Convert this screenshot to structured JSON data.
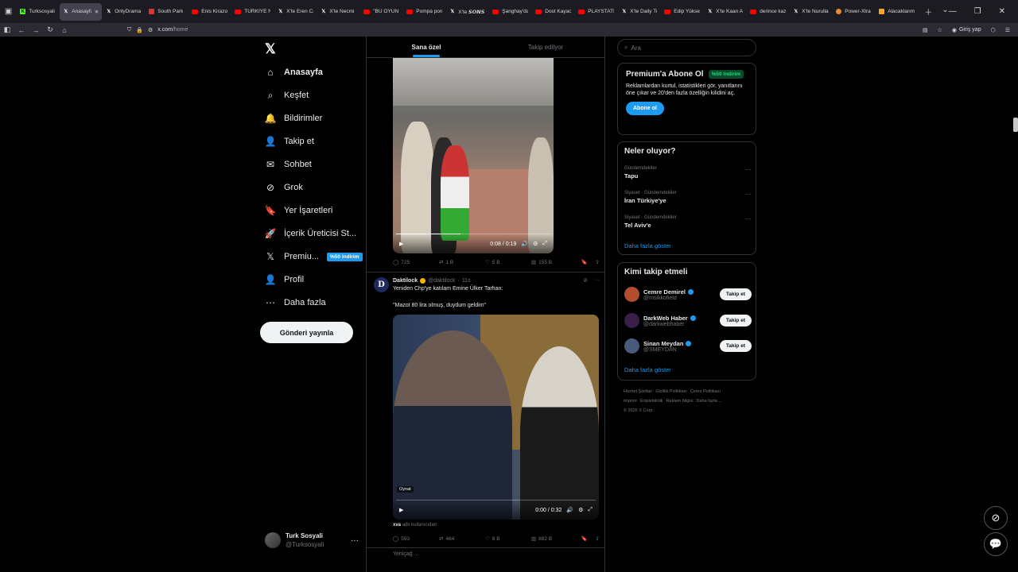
{
  "browser": {
    "tabs": [
      {
        "label": "Turksosyali",
        "fav": "k"
      },
      {
        "label": "Anasayfa",
        "fav": "x",
        "active": true
      },
      {
        "label": "OnlyDrama",
        "fav": "x"
      },
      {
        "label": "South Park",
        "fav": "red"
      },
      {
        "label": "Enis Kirazoğ",
        "fav": "yt"
      },
      {
        "label": "TÜRKİYE NA",
        "fav": "yt"
      },
      {
        "label": "X'te Eren Ca",
        "fav": "x"
      },
      {
        "label": "X'te Necmi",
        "fav": "x"
      },
      {
        "label": "\"BU OYUN",
        "fav": "yt"
      },
      {
        "label": "Pompa porn",
        "fav": "yt"
      },
      {
        "label": "X'te 𝙎𝙊𝙉𝙎",
        "fav": "x"
      },
      {
        "label": "Şanghay'da",
        "fav": "yt"
      },
      {
        "label": "Dost Kayaoğ",
        "fav": "yt"
      },
      {
        "label": "PLAYSTATIC",
        "fav": "yt"
      },
      {
        "label": "X'te Daily Tu",
        "fav": "x"
      },
      {
        "label": "Edip Yüksel",
        "fav": "yt"
      },
      {
        "label": "X'te Kaan Ak",
        "fav": "x"
      },
      {
        "label": "derince kazı",
        "fav": "yt"
      },
      {
        "label": "X'te Nurulla",
        "fav": "x"
      },
      {
        "label": "Power-Xtra",
        "fav": "orange"
      },
      {
        "label": "Alacaklarım",
        "fav": "amber"
      }
    ],
    "url_host": "x.com",
    "url_path": "/home",
    "signin_label": "Giriş yap"
  },
  "nav": {
    "items": [
      {
        "label": "Anasayfa",
        "icon": "home-icon",
        "glyph": "⌂",
        "bold": true
      },
      {
        "label": "Keşfet",
        "icon": "search-icon",
        "glyph": "⌕"
      },
      {
        "label": "Bildirimler",
        "icon": "bell-icon",
        "glyph": "🔔"
      },
      {
        "label": "Takip et",
        "icon": "add-person-icon",
        "glyph": "👤"
      },
      {
        "label": "Sohbet",
        "icon": "mail-icon",
        "glyph": "✉"
      },
      {
        "label": "Grok",
        "icon": "grok-icon",
        "glyph": "⊘"
      },
      {
        "label": "Yer İşaretleri",
        "icon": "bookmark-icon",
        "glyph": "🔖"
      },
      {
        "label": "İçerik Üreticisi St...",
        "icon": "rocket-icon",
        "glyph": "🚀"
      },
      {
        "label": "Premiu...",
        "icon": "x-icon",
        "glyph": "𝕏",
        "badge": "%50 indirim"
      },
      {
        "label": "Profil",
        "icon": "profile-icon",
        "glyph": "👤"
      },
      {
        "label": "Daha fazla",
        "icon": "more-circle-icon",
        "glyph": "⋯"
      }
    ],
    "post_button": "Gönderi yayınla",
    "account": {
      "name": "Turk Sosyali",
      "handle": "@Turksosyali"
    }
  },
  "timeline": {
    "tabs": [
      "Sana özel",
      "Takip edilyor"
    ],
    "tweet1": {
      "video_time": "0:08 / 0:19",
      "video_progress": 0.42,
      "replies": "725",
      "reposts": "1 B",
      "likes": "5 B",
      "views": "155 B"
    },
    "tweet2": {
      "avatar_letter": "D",
      "name": "Daktilock",
      "handle": "@daktilock",
      "time": "11s",
      "text1": "Yeniden Chp'ye katılam Emine Ülker Tarhan:",
      "text2": "\"Mazot 80 lira olmuş, duydum geldim\"",
      "video_tag": "Oynat",
      "video_time": "0:00 / 0:32",
      "credit_user": "xva",
      "credit_text": "adlı kullanıcıdan",
      "replies": "593",
      "reposts": "464",
      "likes": "8 B",
      "views": "882 B"
    },
    "tweet3_partial": "Yeniçağ ..."
  },
  "right": {
    "search_placeholder": "Ara",
    "premium": {
      "title": "Premium'a Abone Ol",
      "discount": "%50 indirim",
      "text": "Reklamlardan kurtul, istatistikleri gör, yanıtlarını öne çıkar ve 20'den fazla özelliğin kilidini aç.",
      "button": "Abone ol"
    },
    "trends": {
      "title": "Neler oluyor?",
      "items": [
        {
          "context": "Gündemdekiler",
          "topic": "Tapu"
        },
        {
          "context": "Siyaset · Gündemdekiler",
          "topic": "İran Türkiye'ye"
        },
        {
          "context": "Siyaset · Gündemdekiler",
          "topic": "Tel Aviv'e"
        }
      ],
      "more": "Daha fazla göster"
    },
    "who_to_follow": {
      "title": "Kimi takip etmeli",
      "items": [
        {
          "name": "Cemre Demirel",
          "handle": "@msikkofield",
          "button": "Takip et",
          "color": "#b34d2e"
        },
        {
          "name": "DarkWeb Haber",
          "handle": "@darkwebhaber",
          "button": "Takip et",
          "color": "#3a1e4a"
        },
        {
          "name": "Sinan Meydan",
          "handle": "@SMEYDAN",
          "button": "Takip et",
          "color": "#4a5a7a"
        }
      ],
      "more": "Daha fazla göster"
    },
    "footer": [
      "Hizmet Şartları",
      "Gizlilik Politikası",
      "Çerez Politikası",
      "Imprint",
      "Erişilebilirlik",
      "Reklam bilgisi",
      "Daha fazla ...",
      "© 2026 X Corp."
    ]
  }
}
